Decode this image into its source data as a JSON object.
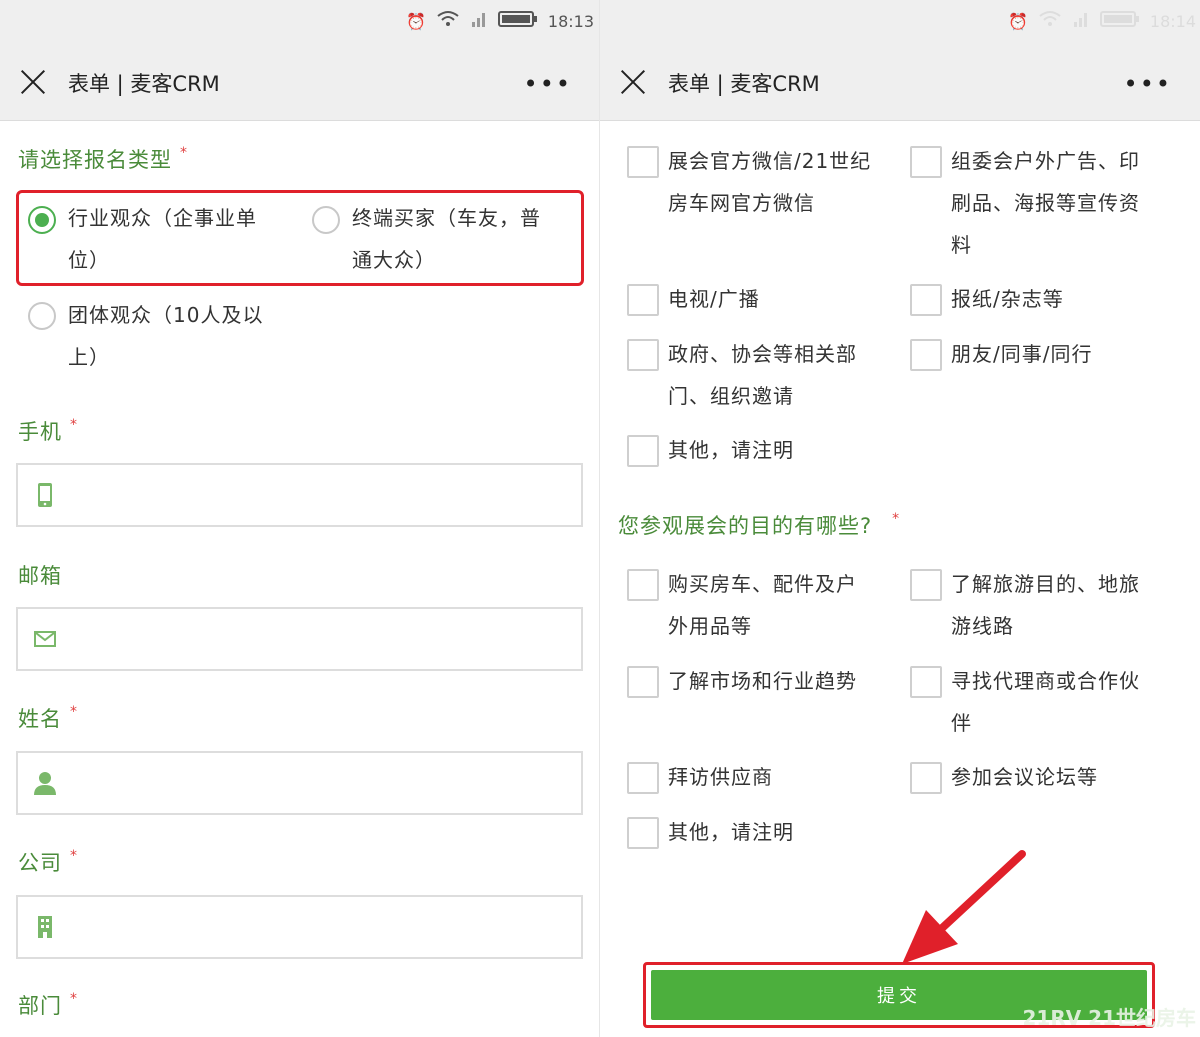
{
  "left": {
    "status": {
      "time": "18:13"
    },
    "nav": {
      "title": "表单 | 麦客CRM",
      "more": "•••"
    },
    "q_type": {
      "label": "请选择报名类型",
      "required": "*",
      "options": [
        {
          "line1": "行业观众（企事业单",
          "line2": "位）",
          "checked": true
        },
        {
          "line1": "终端买家（车友，普",
          "line2": "通大众）",
          "checked": false
        },
        {
          "line1": "团体观众（10人及以",
          "line2": "上）",
          "checked": false
        }
      ]
    },
    "fields": [
      {
        "label": "手机",
        "required": "*",
        "icon": "phone-icon",
        "value": ""
      },
      {
        "label": "邮箱",
        "required": "",
        "icon": "mail-icon",
        "value": ""
      },
      {
        "label": "姓名",
        "required": "*",
        "icon": "user-icon",
        "value": ""
      },
      {
        "label": "公司",
        "required": "*",
        "icon": "building-icon",
        "value": ""
      }
    ],
    "dept": {
      "label": "部门",
      "required": "*"
    }
  },
  "right": {
    "status": {
      "time": "18:14"
    },
    "nav": {
      "title": "表单 | 麦客CRM",
      "more": "•••"
    },
    "source_options": [
      {
        "lines": [
          "展会官方微信/21世纪",
          "房车网官方微信"
        ]
      },
      {
        "lines": [
          "组委会户外广告、印",
          "刷品、海报等宣传资",
          "料"
        ]
      },
      {
        "lines": [
          "电视/广播"
        ]
      },
      {
        "lines": [
          "报纸/杂志等"
        ]
      },
      {
        "lines": [
          "政府、协会等相关部",
          "门、组织邀请"
        ]
      },
      {
        "lines": [
          "朋友/同事/同行"
        ]
      },
      {
        "lines": [
          "其他，请注明"
        ]
      }
    ],
    "q_purpose": {
      "label": "您参观展会的目的有哪些?",
      "required": "*",
      "options": [
        {
          "lines": [
            "购买房车、配件及户",
            "外用品等"
          ]
        },
        {
          "lines": [
            "了解旅游目的、地旅",
            "游线路"
          ]
        },
        {
          "lines": [
            "了解市场和行业趋势"
          ]
        },
        {
          "lines": [
            "寻找代理商或合作伙",
            "伴"
          ]
        },
        {
          "lines": [
            "拜访供应商"
          ]
        },
        {
          "lines": [
            "参加会议论坛等"
          ]
        },
        {
          "lines": [
            "其他，请注明"
          ]
        }
      ]
    },
    "submit_label": "提交",
    "watermark": "21RV 21世纪房车"
  },
  "colors": {
    "accent_green": "#4caf3d",
    "label_green": "#4a8b3a",
    "highlight_red": "#e0202a"
  }
}
